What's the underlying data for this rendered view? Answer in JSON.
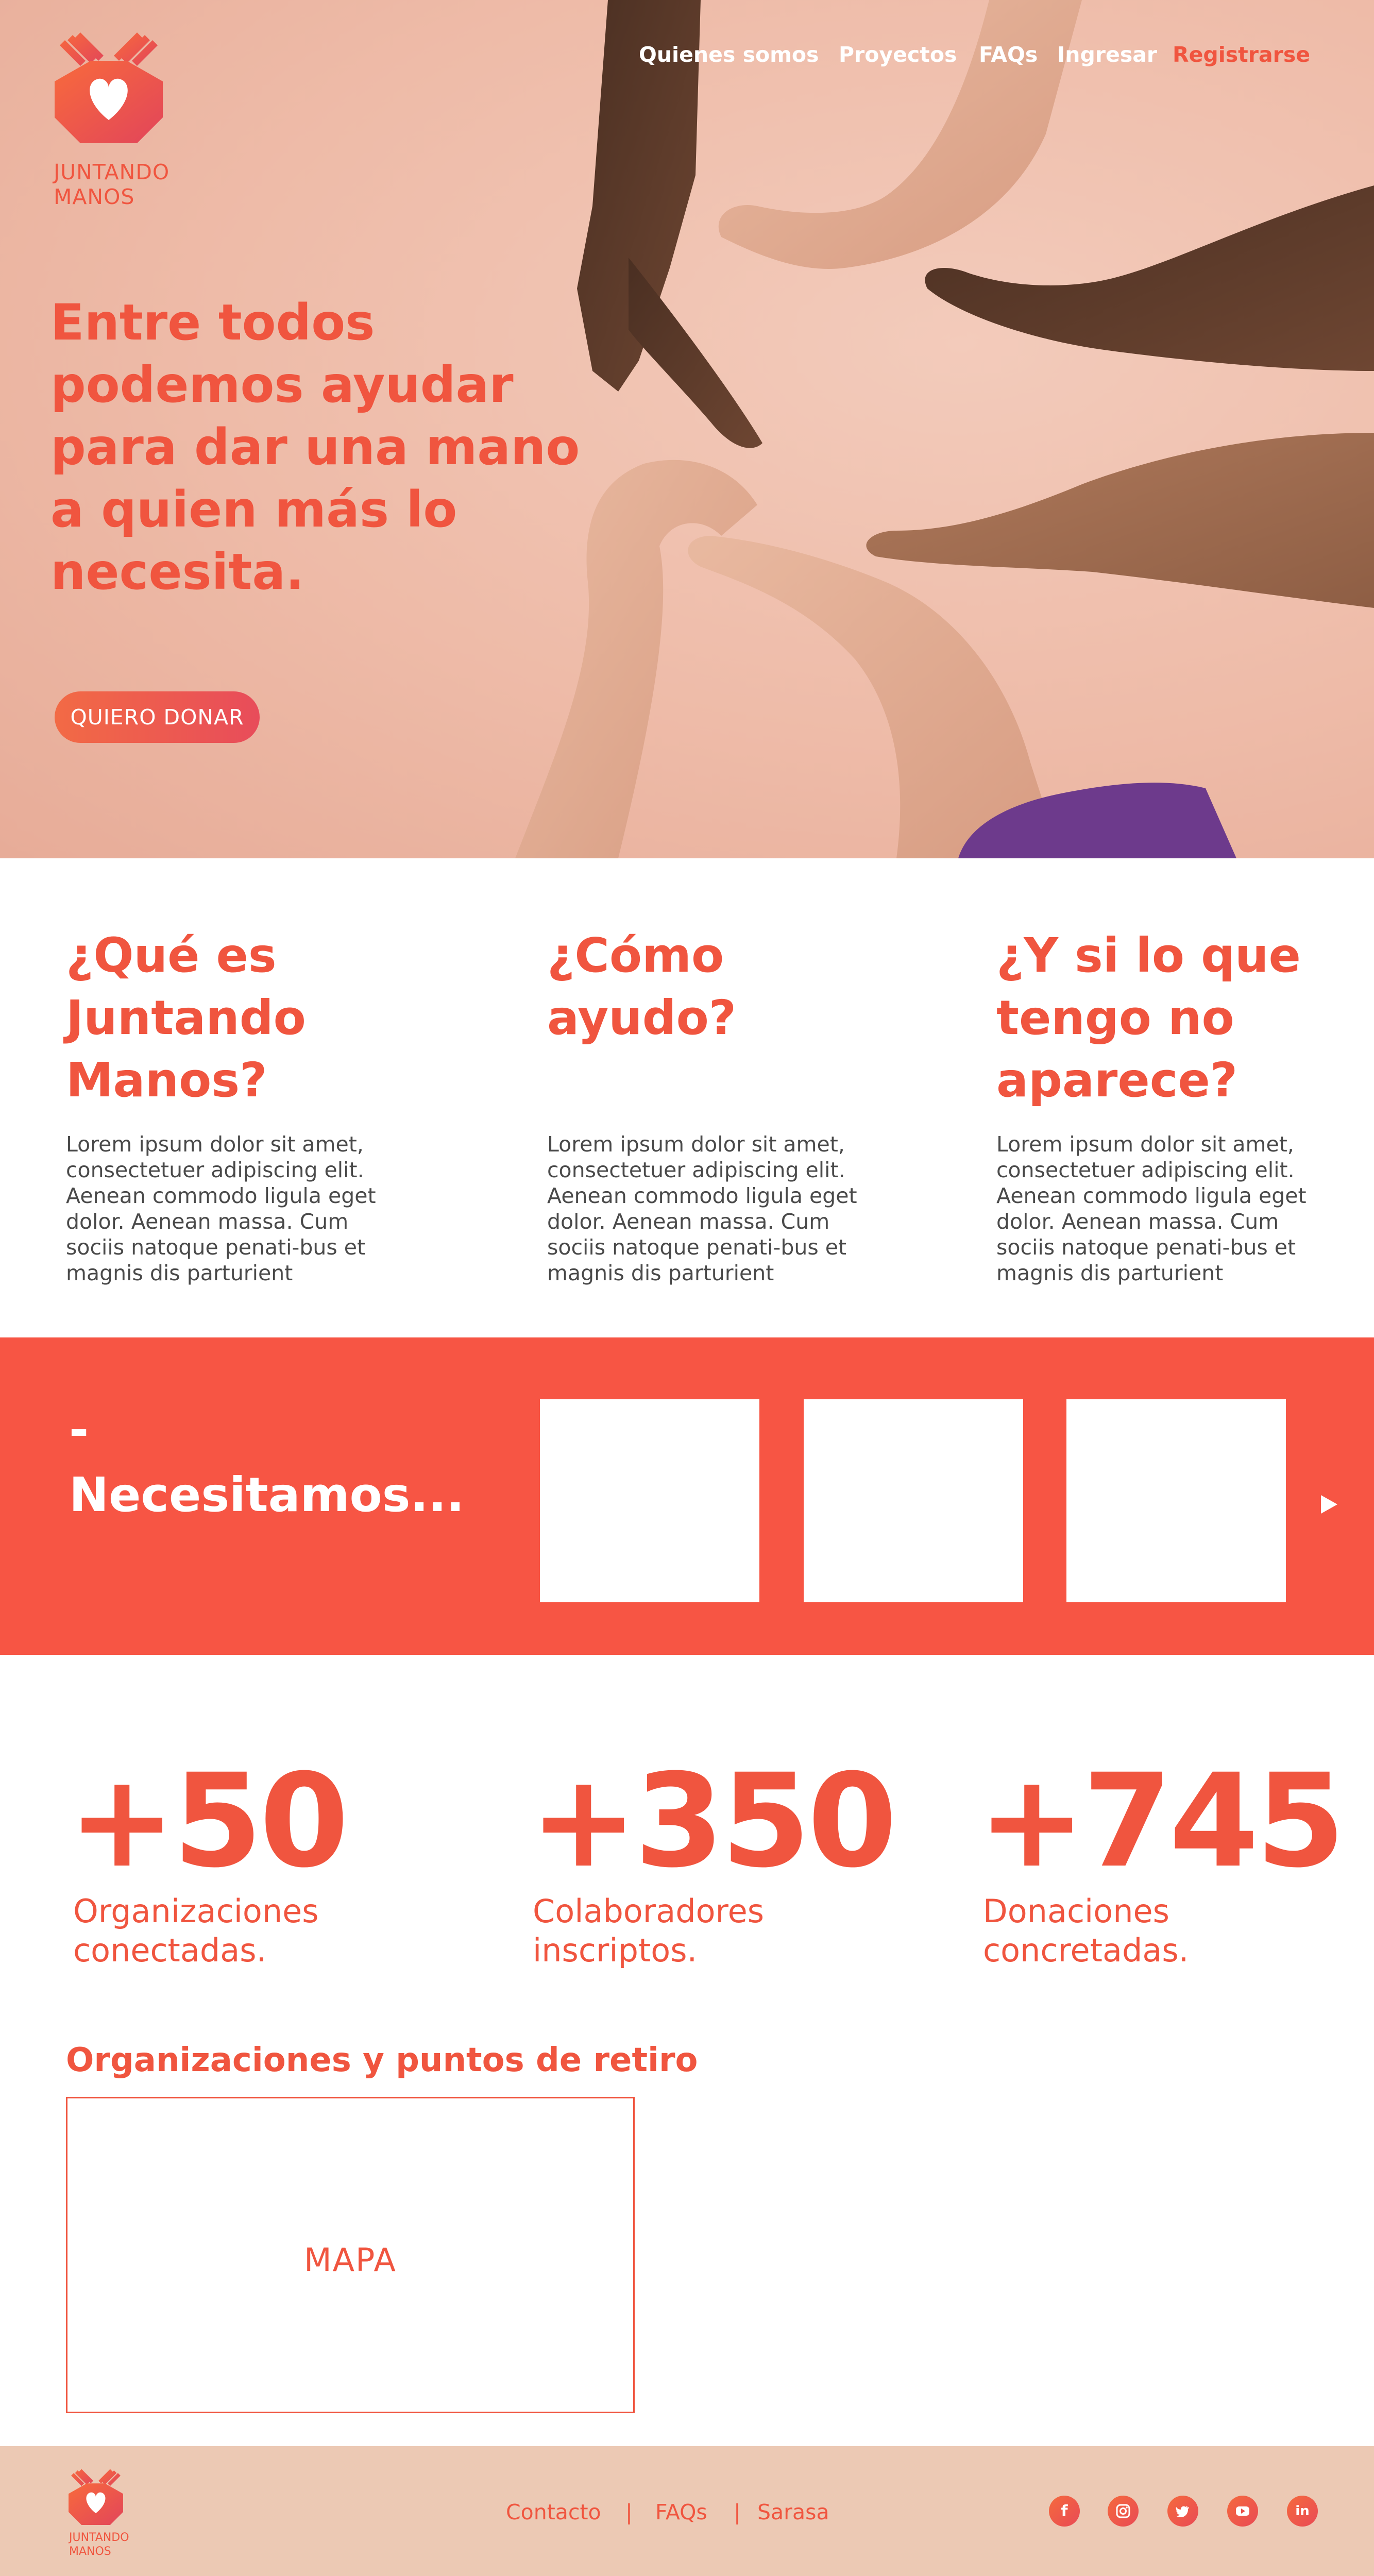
{
  "brand": {
    "logo_text": "JUNTANDO MANOS",
    "primary_color": "#f0553f",
    "band_color": "#f75544",
    "footer_bg": "#ecc9b4"
  },
  "nav": {
    "items": [
      "Quienes somos",
      "Proyectos",
      "FAQs",
      "Ingresar"
    ],
    "register": "Registrarse"
  },
  "hero": {
    "title": "Entre todos podemos ayudar para dar una mano a quien más lo necesita.",
    "button": "QUIERO DONAR"
  },
  "info": [
    {
      "title": "¿Qué es Juntando Manos?",
      "body": "Lorem ipsum dolor sit amet, consectetuer adipiscing elit. Aenean commodo ligula eget dolor. Aenean massa. Cum sociis natoque penati-bus et magnis dis parturient"
    },
    {
      "title": "¿Cómo ayudo?",
      "body": "Lorem ipsum dolor sit amet, consectetuer adipiscing elit. Aenean commodo ligula eget dolor. Aenean massa. Cum sociis natoque penati-bus et magnis dis parturient"
    },
    {
      "title": "¿Y si lo que tengo no aparece?",
      "body": "Lorem ipsum dolor sit amet, consectetuer adipiscing elit. Aenean commodo ligula eget dolor. Aenean massa. Cum sociis natoque penati-bus et magnis dis parturient"
    }
  ],
  "needs": {
    "dash": "-",
    "title": "Necesitamos...",
    "next_icon": "play-arrow-icon"
  },
  "stats": [
    {
      "number": "+50",
      "label": "Organizaciones conectadas."
    },
    {
      "number": "+350",
      "label": "Colaboradores inscriptos."
    },
    {
      "number": "+745",
      "label": "Donaciones concretadas."
    }
  ],
  "map": {
    "title": "Organizaciones y puntos de retiro",
    "placeholder": "MAPA"
  },
  "footer": {
    "links": [
      "Contacto",
      "FAQs",
      "Sarasa"
    ],
    "separator": "|",
    "social": [
      "facebook-icon",
      "instagram-icon",
      "twitter-icon",
      "youtube-icon",
      "linkedin-icon"
    ]
  }
}
